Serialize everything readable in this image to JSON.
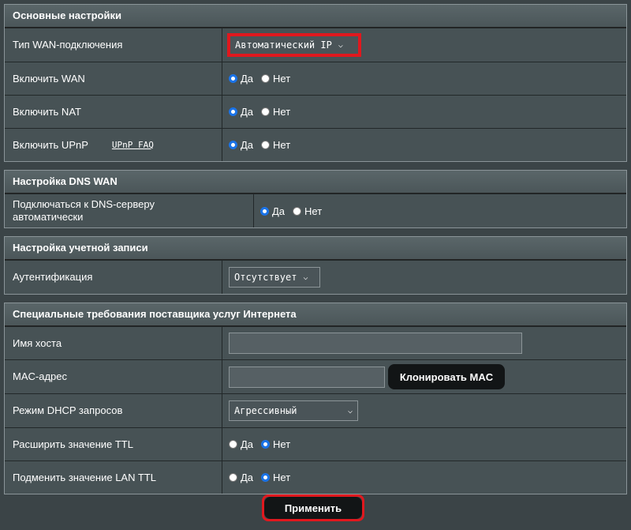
{
  "basic": {
    "title": "Основные настройки",
    "wan_type_label": "Тип WAN-подключения",
    "wan_type_value": "Автоматический IP",
    "enable_wan_label": "Включить WAN",
    "enable_nat_label": "Включить NAT",
    "enable_upnp_label": "Включить UPnP",
    "upnp_faq": "UPnP FAQ"
  },
  "dns": {
    "title": "Настройка DNS WAN",
    "auto_dns_label": "Подключаться к DNS-серверу автоматически"
  },
  "account": {
    "title": "Настройка учетной записи",
    "auth_label": "Аутентификация",
    "auth_value": "Отсутствует"
  },
  "isp": {
    "title": "Специальные требования поставщика услуг Интернета",
    "hostname_label": "Имя хоста",
    "hostname_value": "",
    "mac_label": "MAC-адрес",
    "mac_value": "",
    "clone_mac_button": "Клонировать MAC",
    "dhcp_mode_label": "Режим DHCP запросов",
    "dhcp_mode_value": "Агрессивный",
    "extend_ttl_label": "Расширить значение TTL",
    "spoof_lan_ttl_label": "Подменить значение LAN TTL"
  },
  "radio": {
    "yes": "Да",
    "no": "Нет"
  },
  "apply_button": "Применить"
}
